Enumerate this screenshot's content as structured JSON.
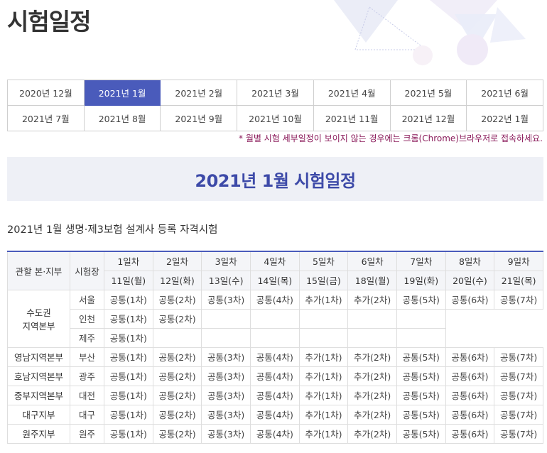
{
  "page": {
    "title": "시험일정"
  },
  "months": [
    {
      "label": "2020년 12월",
      "active": false
    },
    {
      "label": "2021년 1월",
      "active": true
    },
    {
      "label": "2021년 2월",
      "active": false
    },
    {
      "label": "2021년 3월",
      "active": false
    },
    {
      "label": "2021년 4월",
      "active": false
    },
    {
      "label": "2021년 5월",
      "active": false
    },
    {
      "label": "2021년 6월",
      "active": false
    },
    {
      "label": "2021년 7월",
      "active": false
    },
    {
      "label": "2021년 8월",
      "active": false
    },
    {
      "label": "2021년 9월",
      "active": false
    },
    {
      "label": "2021년 10월",
      "active": false
    },
    {
      "label": "2021년 11월",
      "active": false
    },
    {
      "label": "2021년 12월",
      "active": false
    },
    {
      "label": "2022년 1월",
      "active": false
    }
  ],
  "notice": "* 월별 시험 세부일정이 보이지 않는 경우에는 크롬(Chrome)브라우저로 접속하세요.",
  "banner": {
    "title": "2021년 1월 시험일정"
  },
  "exam": {
    "title": "2021년 1월 생명·제3보험 설계사 등록 자격시험"
  },
  "table": {
    "col_headers": {
      "region": "관할 본·지부",
      "site": "시험장"
    },
    "rounds": [
      "1일차",
      "2일차",
      "3일차",
      "4일차",
      "5일차",
      "6일차",
      "7일차",
      "8일차",
      "9일차"
    ],
    "dates": [
      "11일(월)",
      "12일(화)",
      "13일(수)",
      "14일(목)",
      "15일(금)",
      "18일(월)",
      "19일(화)",
      "20일(수)",
      "21일(목)"
    ],
    "groups": [
      {
        "region": "수도권\n지역본부",
        "rows": [
          {
            "site": "서울",
            "cells": [
              "공통(1차)",
              "공통(2차)",
              "공통(3차)",
              "공통(4차)",
              "추가(1차)",
              "추가(2차)",
              "공통(5차)",
              "공통(6차)",
              "공통(7차)"
            ]
          },
          {
            "site": "인천",
            "cells": [
              "공통(1차)",
              "공통(2차)",
              "",
              "",
              "",
              "",
              ""
            ]
          },
          {
            "site": "제주",
            "cells": [
              "공통(1차)",
              "",
              "",
              "",
              "",
              "",
              ""
            ]
          }
        ]
      },
      {
        "region": "영남지역본부",
        "rows": [
          {
            "site": "부산",
            "cells": [
              "공통(1차)",
              "공통(2차)",
              "공통(3차)",
              "공통(4차)",
              "추가(1차)",
              "추가(2차)",
              "공통(5차)",
              "공통(6차)",
              "공통(7차)"
            ]
          }
        ]
      },
      {
        "region": "호남지역본부",
        "rows": [
          {
            "site": "광주",
            "cells": [
              "공통(1차)",
              "공통(2차)",
              "공통(3차)",
              "공통(4차)",
              "추가(1차)",
              "추가(2차)",
              "공통(5차)",
              "공통(6차)",
              "공통(7차)"
            ]
          }
        ]
      },
      {
        "region": "중부지역본부",
        "rows": [
          {
            "site": "대전",
            "cells": [
              "공통(1차)",
              "공통(2차)",
              "공통(3차)",
              "공통(4차)",
              "추가(1차)",
              "추가(2차)",
              "공통(5차)",
              "공통(6차)",
              "공통(7차)"
            ]
          }
        ]
      },
      {
        "region": "대구지부",
        "rows": [
          {
            "site": "대구",
            "cells": [
              "공통(1차)",
              "공통(2차)",
              "공통(3차)",
              "공통(4차)",
              "추가(1차)",
              "추가(2차)",
              "공통(5차)",
              "공통(6차)",
              "공통(7차)"
            ]
          }
        ]
      },
      {
        "region": "원주지부",
        "rows": [
          {
            "site": "원주",
            "cells": [
              "공통(1차)",
              "공통(2차)",
              "공통(3차)",
              "공통(4차)",
              "추가(1차)",
              "추가(2차)",
              "공통(5차)",
              "공통(6차)",
              "공통(7차)"
            ]
          }
        ]
      }
    ]
  },
  "colors": {
    "accent": "#4a5bbb",
    "banner_bg": "#eef0f6",
    "banner_text": "#3d4aa8",
    "notice": "#8a1a5a"
  }
}
